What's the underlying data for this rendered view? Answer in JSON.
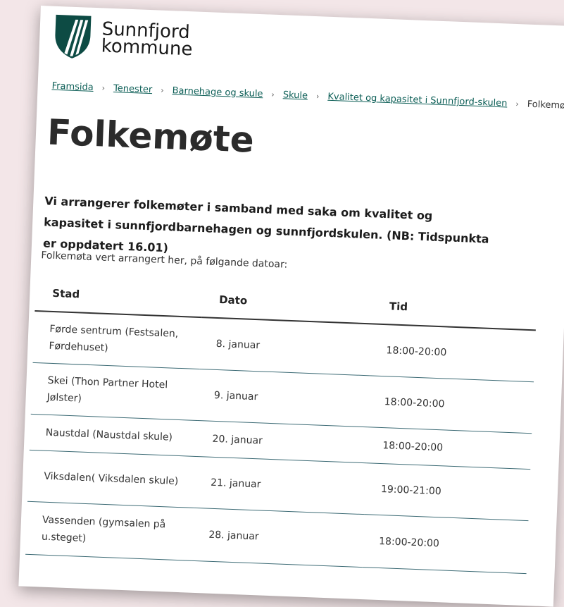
{
  "header": {
    "logo_line1": "Sunnfjord",
    "logo_line2": "kommune",
    "brand_color": "#0d4b44"
  },
  "breadcrumb": {
    "items": [
      "Framsida",
      "Tenester",
      "Barnehage og skule",
      "Skule",
      "Kvalitet og kapasitet i Sunnfjord-skulen"
    ],
    "current": "Folkemøte"
  },
  "page": {
    "title": "Folkemøte",
    "intro": "Vi arrangerer folkemøter i samband med saka om kvalitet og kapasitet i sunnfjordbarnehagen og sunnfjordskulen. (NB: Tidspunkta er oppdatert 16.01)",
    "lead": "Folkemøta vert arrangert her, på følgande datoar:"
  },
  "table": {
    "headers": [
      "Stad",
      "Dato",
      "Tid"
    ],
    "rows": [
      {
        "stad": "Førde sentrum (Festsalen, Førdehuset)",
        "dato": "8. januar",
        "tid": "18:00-20:00"
      },
      {
        "stad": "Skei (Thon Partner Hotel Jølster)",
        "dato": "9. januar",
        "tid": "18:00-20:00"
      },
      {
        "stad": "Naustdal (Naustdal skule)",
        "dato": "20. januar",
        "tid": "18:00-20:00"
      },
      {
        "stad": "Viksdalen( Viksdalen skule)",
        "dato": "21. januar",
        "tid": "19:00-21:00"
      },
      {
        "stad": "Vassenden (gymsalen på u.steget)",
        "dato": "28. januar",
        "tid": "18:00-20:00"
      }
    ]
  }
}
